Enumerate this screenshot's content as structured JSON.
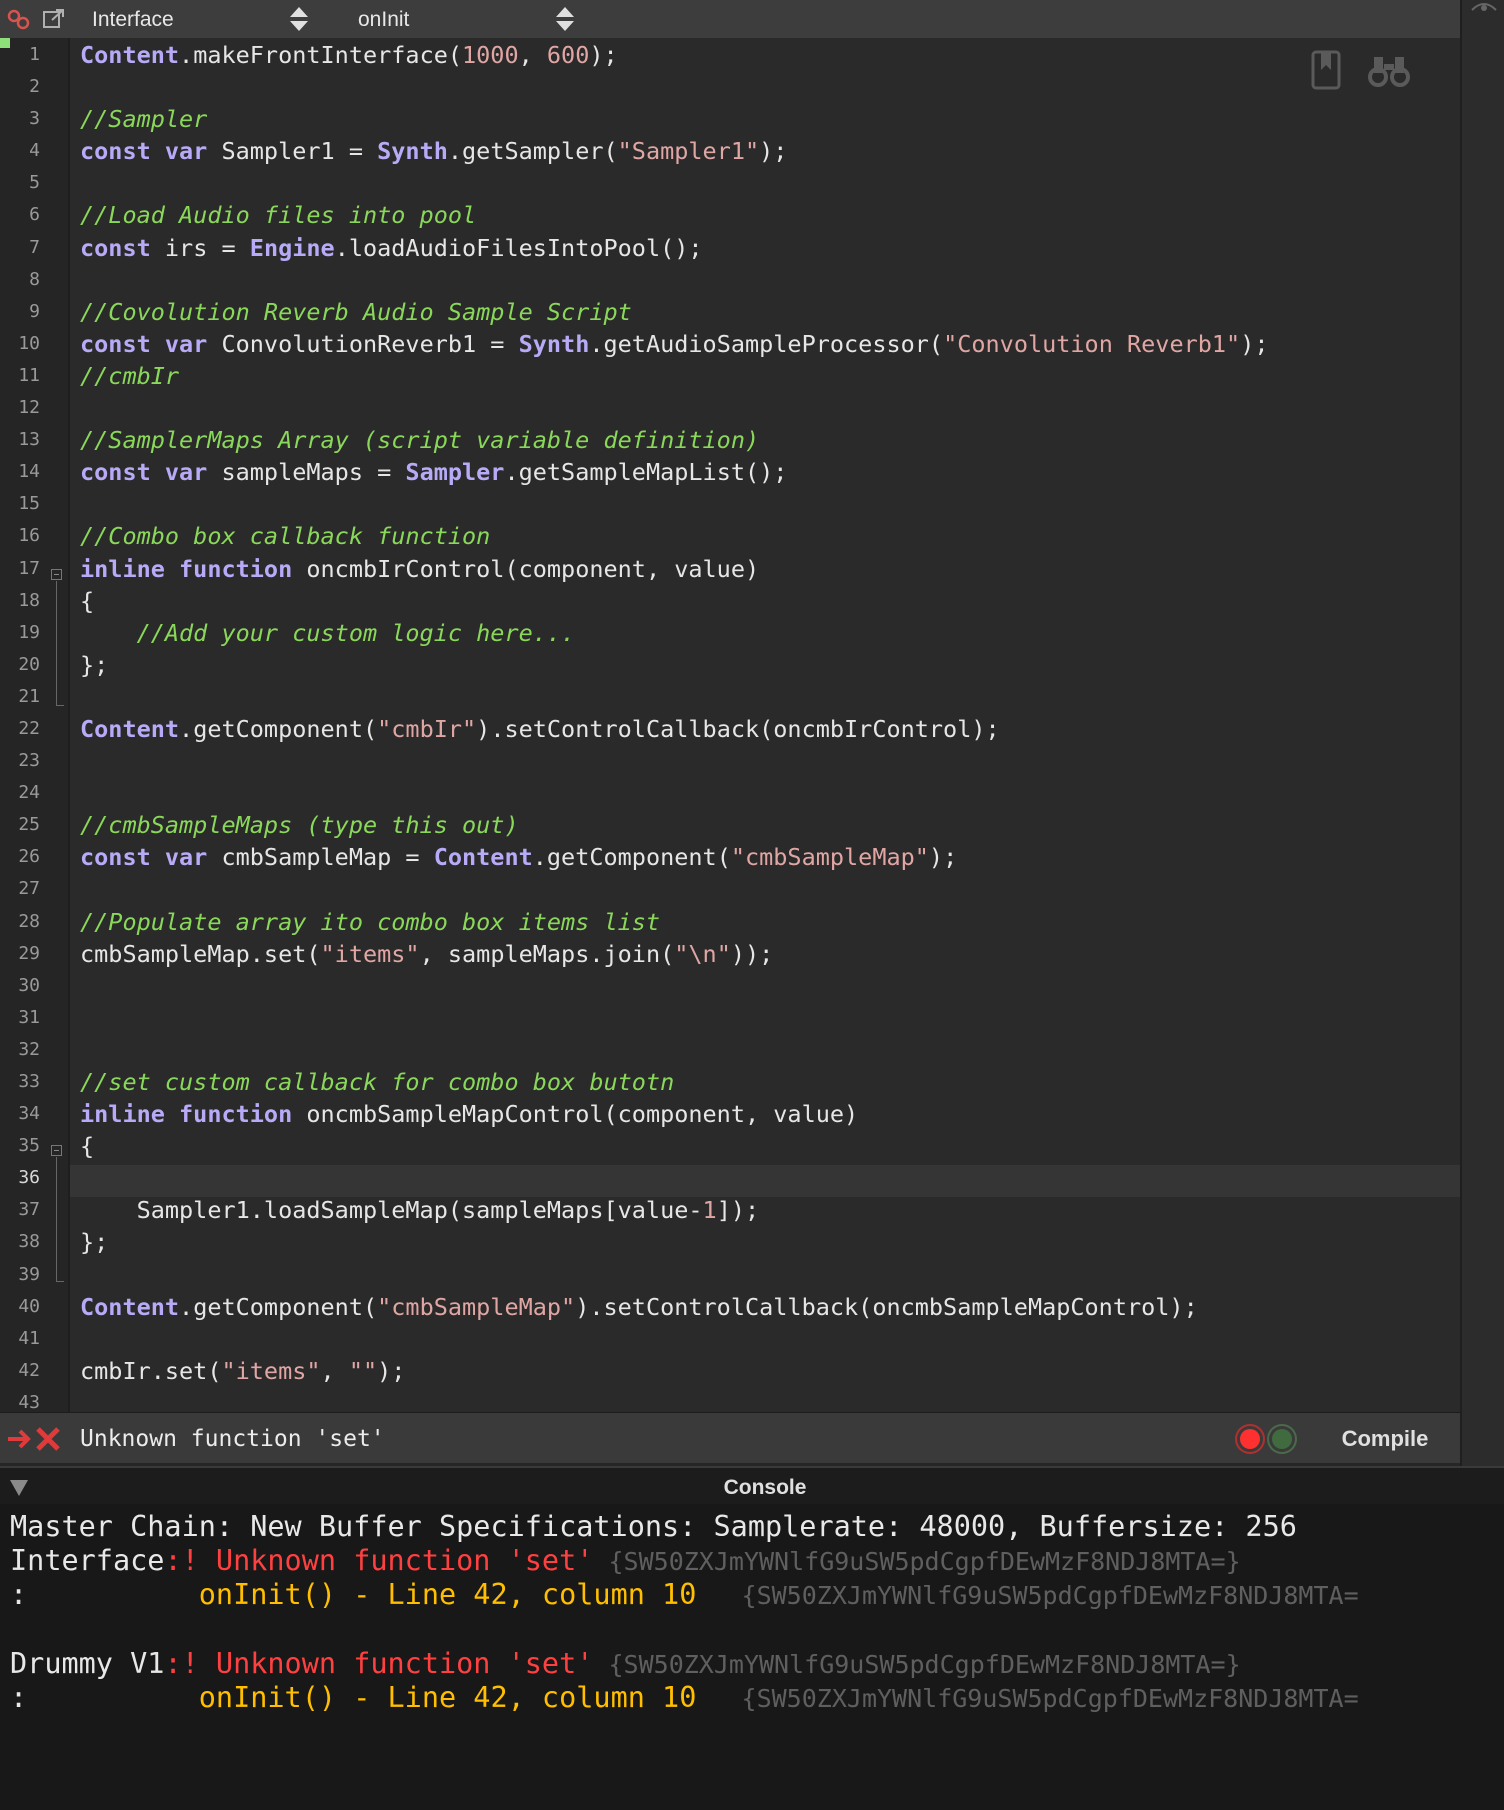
{
  "toolbar": {
    "processor": "Interface",
    "callback": "onInit"
  },
  "editor": {
    "line_numbers": [
      "1",
      "2",
      "3",
      "4",
      "5",
      "6",
      "7",
      "8",
      "9",
      "10",
      "11",
      "12",
      "13",
      "14",
      "15",
      "16",
      "17",
      "18",
      "19",
      "20",
      "21",
      "22",
      "23",
      "24",
      "25",
      "26",
      "27",
      "28",
      "29",
      "30",
      "31",
      "32",
      "33",
      "34",
      "35",
      "36",
      "37",
      "38",
      "39",
      "40",
      "41",
      "42",
      "43"
    ],
    "current_line": 36,
    "tools": [
      "bookmark-icon",
      "binoculars-icon"
    ]
  },
  "status": {
    "error_message": "Unknown function 'set'",
    "compile_label": "Compile"
  },
  "console": {
    "title": "Console",
    "line1": {
      "source": "Master Chain",
      "text": ": New Buffer Specifications: Samplerate: 48000, Buffersize: 256"
    },
    "error1": {
      "source": "Interface",
      "marker": ":! ",
      "message": "Unknown function 'set'",
      "hash": "{SW50ZXJmYWNlfG9uSW5pdCgpfDEwMzF8NDJ8MTA=}"
    },
    "loc1": {
      "colon": ":",
      "location": "onInit() - Line 42, column 10",
      "hash": "{SW50ZXJmYWNlfG9uSW5pdCgpfDEwMzF8NDJ8MTA="
    },
    "error2": {
      "source": "Drummy V1",
      "marker": ":! ",
      "message": "Unknown function 'set'",
      "hash": "{SW50ZXJmYWNlfG9uSW5pdCgpfDEwMzF8NDJ8MTA=}"
    },
    "loc2": {
      "colon": ":",
      "location": "onInit() - Line 42, column 10",
      "hash": "{SW50ZXJmYWNlfG9uSW5pdCgpfDEwMzF8NDJ8MTA="
    }
  },
  "colors": {
    "keyword": "#b9aaf7",
    "string": "#e0a6a4",
    "comment": "#8ad85a",
    "error_red": "#ff4040",
    "warning_orange": "#ffbf00"
  },
  "code": {
    "l1": [
      [
        "obj",
        "Content"
      ],
      [
        "pl",
        ".makeFrontInterface("
      ],
      [
        "num",
        "1000"
      ],
      [
        "pl",
        ", "
      ],
      [
        "num",
        "600"
      ],
      [
        "pl",
        ");"
      ]
    ],
    "l2": [],
    "l3": [
      [
        "com",
        "//Sampler"
      ]
    ],
    "l4": [
      [
        "kw",
        "const var"
      ],
      [
        "pl",
        " Sampler1 = "
      ],
      [
        "obj",
        "Synth"
      ],
      [
        "pl",
        ".getSampler("
      ],
      [
        "str",
        "\"Sampler1\""
      ],
      [
        "pl",
        ");"
      ]
    ],
    "l5": [],
    "l6": [
      [
        "com",
        "//Load Audio files into pool"
      ]
    ],
    "l7": [
      [
        "kw",
        "const"
      ],
      [
        "pl",
        " irs = "
      ],
      [
        "obj",
        "Engine"
      ],
      [
        "pl",
        ".loadAudioFilesIntoPool();"
      ]
    ],
    "l8": [],
    "l9": [
      [
        "com",
        "//Covolution Reverb Audio Sample Script"
      ]
    ],
    "l10": [
      [
        "kw",
        "const var"
      ],
      [
        "pl",
        " ConvolutionReverb1 = "
      ],
      [
        "obj",
        "Synth"
      ],
      [
        "pl",
        ".getAudioSampleProcessor("
      ],
      [
        "str",
        "\"Convolution Reverb1\""
      ],
      [
        "pl",
        ");"
      ]
    ],
    "l11": [
      [
        "com",
        "//cmbIr"
      ]
    ],
    "l12": [],
    "l13": [
      [
        "com",
        "//SamplerMaps Array (script variable definition)"
      ]
    ],
    "l14": [
      [
        "kw",
        "const var"
      ],
      [
        "pl",
        " sampleMaps = "
      ],
      [
        "obj",
        "Sampler"
      ],
      [
        "pl",
        ".getSampleMapList();"
      ]
    ],
    "l15": [],
    "l16": [
      [
        "com",
        "//Combo box callback function"
      ]
    ],
    "l17": [
      [
        "kw",
        "inline function"
      ],
      [
        "pl",
        " oncmbIrControl(component, value)"
      ]
    ],
    "l18": [
      [
        "pl",
        "{"
      ]
    ],
    "l19": [
      [
        "pl",
        "    "
      ],
      [
        "com",
        "//Add your custom logic here..."
      ]
    ],
    "l20": [
      [
        "pl",
        "};"
      ]
    ],
    "l21": [],
    "l22": [
      [
        "obj",
        "Content"
      ],
      [
        "pl",
        ".getComponent("
      ],
      [
        "str",
        "\"cmbIr\""
      ],
      [
        "pl",
        ").setControlCallback(oncmbIrControl);"
      ]
    ],
    "l23": [],
    "l24": [],
    "l25": [
      [
        "com",
        "//cmbSampleMaps (type this out)"
      ]
    ],
    "l26": [
      [
        "kw",
        "const var"
      ],
      [
        "pl",
        " cmbSampleMap = "
      ],
      [
        "obj",
        "Content"
      ],
      [
        "pl",
        ".getComponent("
      ],
      [
        "str",
        "\"cmbSampleMap\""
      ],
      [
        "pl",
        ");"
      ]
    ],
    "l27": [],
    "l28": [
      [
        "com",
        "//Populate array ito combo box items list"
      ]
    ],
    "l29": [
      [
        "pl",
        "cmbSampleMap.set("
      ],
      [
        "str",
        "\"items\""
      ],
      [
        "pl",
        ", sampleMaps.join("
      ],
      [
        "str",
        "\"\\n\""
      ],
      [
        "pl",
        "));"
      ]
    ],
    "l30": [],
    "l31": [],
    "l32": [],
    "l33": [
      [
        "com",
        "//set custom callback for combo box butotn"
      ]
    ],
    "l34": [
      [
        "kw",
        "inline function"
      ],
      [
        "pl",
        " oncmbSampleMapControl(component, value)"
      ]
    ],
    "l35": [
      [
        "pl",
        "{"
      ]
    ],
    "l36": [],
    "l37": [
      [
        "pl",
        "    Sampler1.loadSampleMap(sampleMaps[value-"
      ],
      [
        "num",
        "1"
      ],
      [
        "pl",
        "]);"
      ]
    ],
    "l38": [
      [
        "pl",
        "};"
      ]
    ],
    "l39": [],
    "l40": [
      [
        "obj",
        "Content"
      ],
      [
        "pl",
        ".getComponent("
      ],
      [
        "str",
        "\"cmbSampleMap\""
      ],
      [
        "pl",
        ").setControlCallback(oncmbSampleMapControl);"
      ]
    ],
    "l41": [],
    "l42": [
      [
        "pl",
        "cmbIr.set("
      ],
      [
        "str",
        "\"items\""
      ],
      [
        "pl",
        ", "
      ],
      [
        "str",
        "\"\""
      ],
      [
        "pl",
        ");"
      ]
    ],
    "l43": []
  }
}
